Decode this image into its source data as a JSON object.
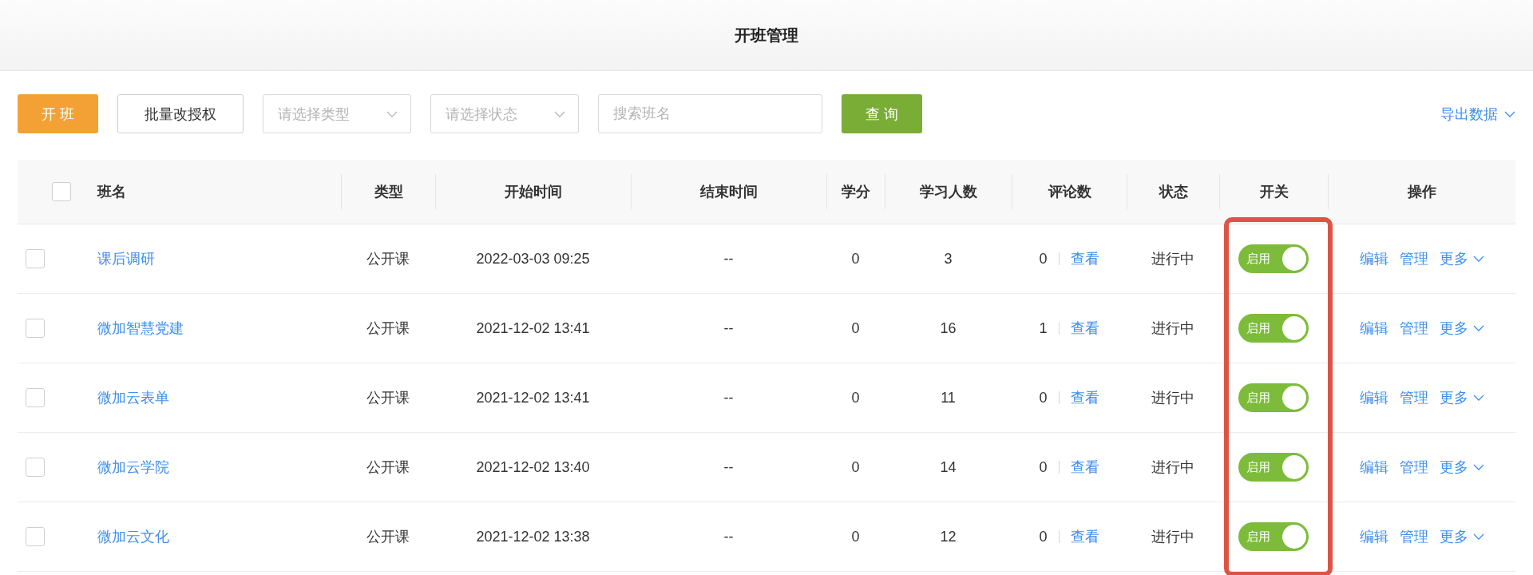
{
  "header": {
    "title": "开班管理"
  },
  "toolbar": {
    "open_button": "开 班",
    "batch_button": "批量改授权",
    "type_select": {
      "placeholder": "请选择类型"
    },
    "status_select": {
      "placeholder": "请选择状态"
    },
    "search": {
      "placeholder": "搜索班名"
    },
    "query_button": "查 询",
    "export_link": "导出数据"
  },
  "table": {
    "select_all": {
      "checked": false
    },
    "columns": [
      {
        "label": "班名",
        "highlighted": false
      },
      {
        "label": "类型",
        "highlighted": false
      },
      {
        "label": "开始时间",
        "highlighted": false
      },
      {
        "label": "结束时间",
        "highlighted": false
      },
      {
        "label": "学分",
        "highlighted": false
      },
      {
        "label": "学习人数",
        "highlighted": false
      },
      {
        "label": "评论数",
        "highlighted": false
      },
      {
        "label": "状态",
        "highlighted": false
      },
      {
        "label": "开关",
        "highlighted": true
      },
      {
        "label": "操作",
        "highlighted": false
      }
    ],
    "rows": [
      {
        "checked": false,
        "name": "课后调研",
        "type": "公开课",
        "start": "2022-03-03 09:25",
        "end": "--",
        "credit": "0",
        "learners": "3",
        "comments": "0",
        "view": "查看",
        "status": "进行中",
        "switch": {
          "label": "启用",
          "on": true
        },
        "actions": [
          "编辑",
          "管理",
          "更多"
        ]
      },
      {
        "checked": false,
        "name": "微加智慧党建",
        "type": "公开课",
        "start": "2021-12-02 13:41",
        "end": "--",
        "credit": "0",
        "learners": "16",
        "comments": "1",
        "view": "查看",
        "status": "进行中",
        "switch": {
          "label": "启用",
          "on": true
        },
        "actions": [
          "编辑",
          "管理",
          "更多"
        ]
      },
      {
        "checked": false,
        "name": "微加云表单",
        "type": "公开课",
        "start": "2021-12-02 13:41",
        "end": "--",
        "credit": "0",
        "learners": "11",
        "comments": "0",
        "view": "查看",
        "status": "进行中",
        "switch": {
          "label": "启用",
          "on": true
        },
        "actions": [
          "编辑",
          "管理",
          "更多"
        ]
      },
      {
        "checked": false,
        "name": "微加云学院",
        "type": "公开课",
        "start": "2021-12-02 13:40",
        "end": "--",
        "credit": "0",
        "learners": "14",
        "comments": "0",
        "view": "查看",
        "status": "进行中",
        "switch": {
          "label": "启用",
          "on": true
        },
        "actions": [
          "编辑",
          "管理",
          "更多"
        ]
      },
      {
        "checked": false,
        "name": "微加云文化",
        "type": "公开课",
        "start": "2021-12-02 13:38",
        "end": "--",
        "credit": "0",
        "learners": "12",
        "comments": "0",
        "view": "查看",
        "status": "进行中",
        "switch": {
          "label": "启用",
          "on": true
        },
        "actions": [
          "编辑",
          "管理",
          "更多"
        ]
      }
    ]
  }
}
